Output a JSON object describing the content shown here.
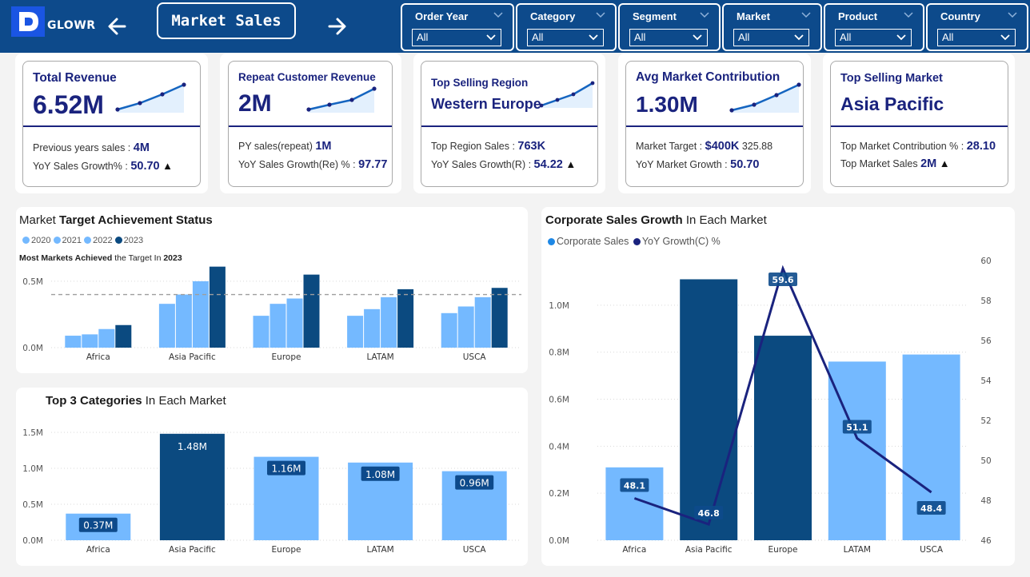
{
  "app": {
    "logo_text": "GLOWR",
    "page_title": "Market Sales"
  },
  "filters": [
    {
      "label": "Order Year",
      "value": "All"
    },
    {
      "label": "Category",
      "value": "All"
    },
    {
      "label": "Segment",
      "value": "All"
    },
    {
      "label": "Market",
      "value": "All"
    },
    {
      "label": "Product",
      "value": "All"
    },
    {
      "label": "Country",
      "value": "All"
    }
  ],
  "kpis": [
    {
      "title": "Total Revenue",
      "value": "6.52M",
      "row1_label": "Previous years sales :",
      "row1_value": "4M",
      "row2_label": "YoY Sales Growth% :",
      "row2_value": "50.70",
      "row2_trend": "▲"
    },
    {
      "title": "Repeat Customer Revenue",
      "value": "2M",
      "row1_label": "PY sales(repeat)",
      "row1_value": "1M",
      "row2_label": "YoY Sales Growth(Re) % :",
      "row2_value": "97.77"
    },
    {
      "title": "Top Selling Region",
      "value": "Western Europe",
      "row1_label": "Top Region Sales :",
      "row1_value": "763K",
      "row2_label": "YoY Sales Growth(R) :",
      "row2_value": "54.22",
      "row2_trend": "▲"
    },
    {
      "title": "Avg Market Contribution",
      "value": "1.30M",
      "row1_label": "Market Target :",
      "row1_value": "$400K",
      "row1_extra": "325.88",
      "row2_label": "YoY Market Growth :",
      "row2_value": "50.70"
    },
    {
      "title": "Top Selling Market",
      "value": "Asia Pacific",
      "row1_label": "Top Market Contribution % :",
      "row1_value": "28.10",
      "row2_label": "Top Market Sales",
      "row2_value": "2M",
      "row2_trend": "▲"
    }
  ],
  "colors": {
    "navy": "#0d4a8b",
    "light_blue": "#74b9ff",
    "dark_series": "#0b4a80",
    "line_series": "#1a237e",
    "text_value": "#1a237e"
  },
  "chart_target": {
    "title_plain": "Market ",
    "title_bold": "Target Achievement Status",
    "subtitle_bold1": "Most Markets Achieved",
    "subtitle_plain": " the Target In ",
    "subtitle_bold2": "2023",
    "legend": [
      "2020",
      "2021",
      "2022",
      "2023"
    ]
  },
  "chart_top3": {
    "title_bold": "Top 3 Categories",
    "title_plain": " In Each Market"
  },
  "chart_corp": {
    "title_bold": "Corporate Sales Growth",
    "title_plain": " In Each Market",
    "legend": [
      "Corporate Sales",
      "YoY Growth(C) %"
    ]
  },
  "chart_data": [
    {
      "type": "bar",
      "title": "Market Target Achievement Status",
      "categories": [
        "Africa",
        "Asia Pacific",
        "Europe",
        "LATAM",
        "USCA"
      ],
      "series": [
        {
          "name": "2020",
          "values": [
            0.09,
            0.33,
            0.24,
            0.24,
            0.26
          ]
        },
        {
          "name": "2021",
          "values": [
            0.1,
            0.4,
            0.33,
            0.29,
            0.31
          ]
        },
        {
          "name": "2022",
          "values": [
            0.14,
            0.5,
            0.37,
            0.38,
            0.38
          ]
        },
        {
          "name": "2023",
          "values": [
            0.17,
            0.61,
            0.55,
            0.44,
            0.45
          ]
        }
      ],
      "target_line": 0.4,
      "y_ticks": [
        "0.0M",
        "0.5M"
      ],
      "ylim": [
        0,
        0.65
      ],
      "legend_position": "top-left"
    },
    {
      "type": "bar",
      "title": "Top 3 Categories In Each Market",
      "categories": [
        "Africa",
        "Asia Pacific",
        "Europe",
        "LATAM",
        "USCA"
      ],
      "values": [
        0.37,
        1.48,
        1.16,
        1.08,
        0.96
      ],
      "labels": [
        "0.37M",
        "1.48M",
        "1.16M",
        "1.08M",
        "0.96M"
      ],
      "y_ticks": [
        "0.0M",
        "0.5M",
        "1.0M",
        "1.5M"
      ],
      "ylim": [
        0,
        1.6
      ]
    },
    {
      "type": "bar",
      "title": "Corporate Sales Growth In Each Market",
      "categories": [
        "Africa",
        "Asia Pacific",
        "Europe",
        "LATAM",
        "USCA"
      ],
      "series": [
        {
          "name": "Corporate Sales",
          "values": [
            0.31,
            1.11,
            0.87,
            0.76,
            0.79
          ]
        },
        {
          "name": "YoY Growth(C) %",
          "values": [
            48.1,
            46.8,
            59.6,
            51.1,
            48.4
          ]
        }
      ],
      "labels": [
        "48.1",
        "46.8",
        "59.6",
        "51.1",
        "48.4"
      ],
      "y_ticks": [
        "0.0M",
        "0.2M",
        "0.4M",
        "0.6M",
        "0.8M",
        "1.0M"
      ],
      "y2_ticks": [
        "46",
        "48",
        "50",
        "52",
        "54",
        "56",
        "58",
        "60"
      ],
      "ylim": [
        0,
        1.2
      ],
      "y2lim": [
        46,
        60
      ],
      "legend_position": "top-left"
    }
  ]
}
